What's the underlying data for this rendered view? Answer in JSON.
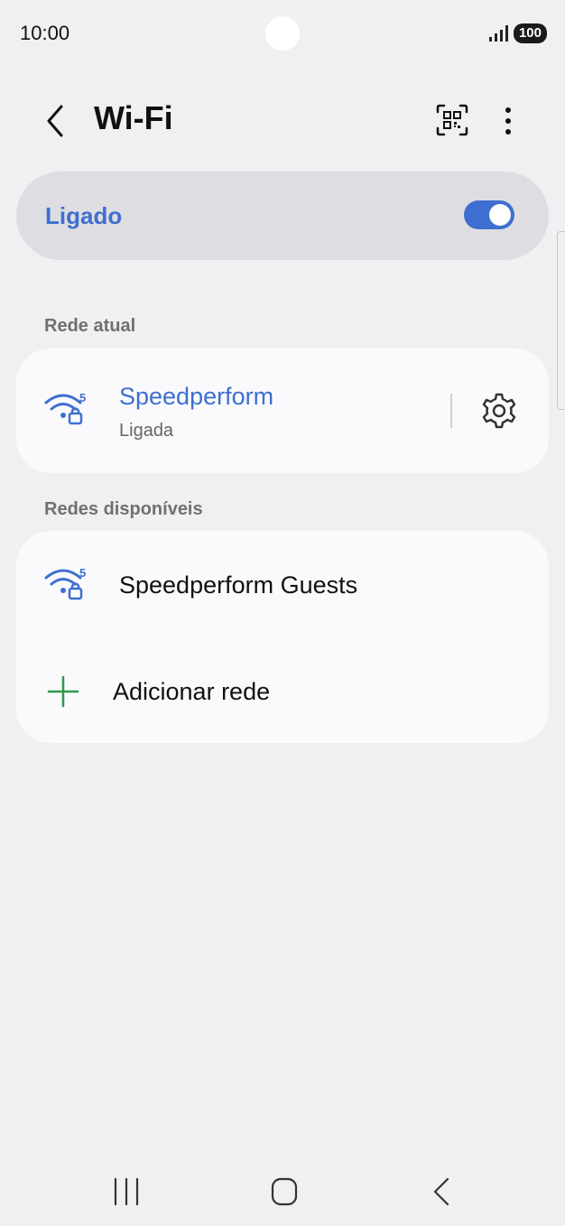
{
  "status_bar": {
    "time": "10:00",
    "battery": "100",
    "signal_icon": "signal-bars-icon"
  },
  "header": {
    "title": "Wi-Fi",
    "back_icon": "chevron-left-icon",
    "qr_icon": "qr-code-scan-icon",
    "more_icon": "more-vertical-icon"
  },
  "master_toggle": {
    "label": "Ligado",
    "state": "on",
    "accent_color": "#3e6fd0"
  },
  "current_network_section": {
    "label": "Rede atual",
    "network": {
      "name": "Speedperform",
      "status": "Ligada",
      "band": "5",
      "icon": "wifi-secured-icon",
      "settings_icon": "gear-icon"
    }
  },
  "available_networks_section": {
    "label": "Redes disponíveis",
    "networks": [
      {
        "name": "Speedperform Guests",
        "band": "5",
        "icon": "wifi-secured-icon"
      }
    ],
    "add_network": {
      "label": "Adicionar rede",
      "icon": "plus-icon"
    }
  },
  "nav_bar": {
    "recents_icon": "recents-icon",
    "home_icon": "home-icon",
    "back_icon": "back-icon"
  }
}
